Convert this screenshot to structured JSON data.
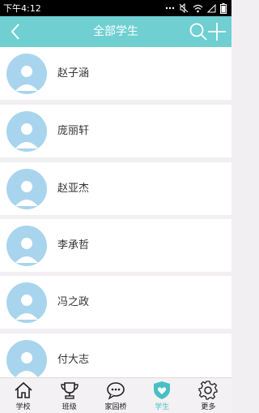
{
  "status_bar": {
    "time": "下午4:12"
  },
  "header": {
    "title": "全部学生"
  },
  "students": [
    {
      "name": "赵子涵"
    },
    {
      "name": "庞丽轩"
    },
    {
      "name": "赵亚杰"
    },
    {
      "name": "李承哲"
    },
    {
      "name": "冯之政"
    },
    {
      "name": "付大志"
    }
  ],
  "tabs": [
    {
      "label": "学校",
      "icon": "house-icon"
    },
    {
      "label": "班级",
      "icon": "trophy-icon"
    },
    {
      "label": "家园桥",
      "icon": "chat-bubble-icon"
    },
    {
      "label": "学生",
      "icon": "shield-heart-icon",
      "active": true
    },
    {
      "label": "更多",
      "icon": "gear-icon"
    }
  ],
  "colors": {
    "accent": "#6fcfd1",
    "active_tab": "#49bfc4",
    "avatar": "#a9d4ee"
  }
}
